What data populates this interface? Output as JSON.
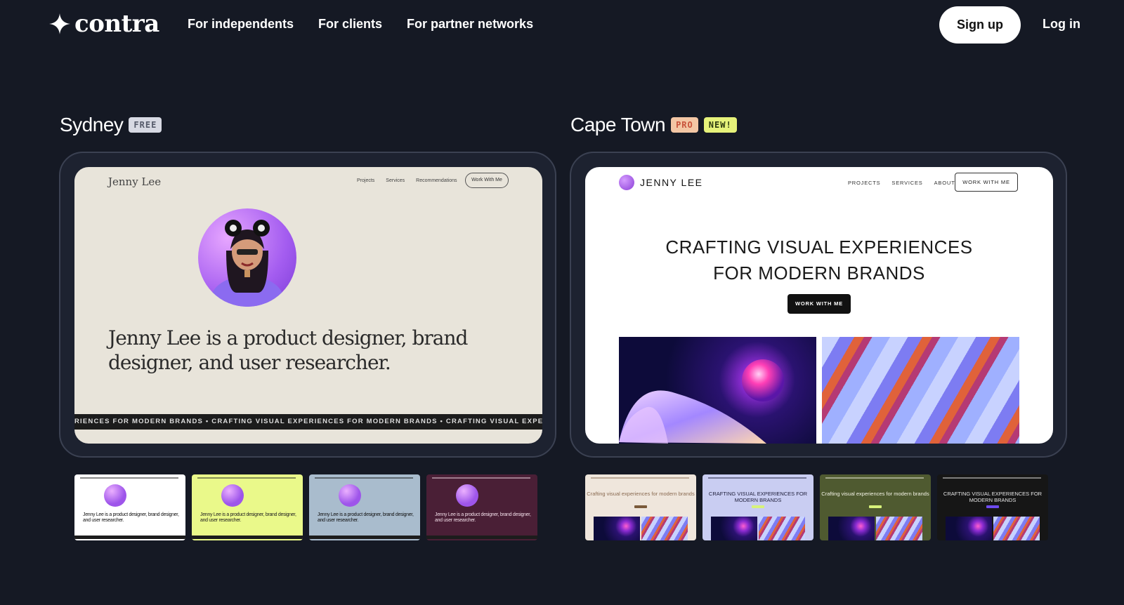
{
  "header": {
    "logo_text": "contra",
    "nav": [
      "For independents",
      "For clients",
      "For partner networks"
    ],
    "signup_label": "Sign up",
    "login_label": "Log in"
  },
  "templates": [
    {
      "name": "Sydney",
      "badges": [
        "FREE"
      ],
      "preview": {
        "brand": "Jenny Lee",
        "nav": [
          "Projects",
          "Services",
          "Recommendations"
        ],
        "cta": "Work With Me",
        "headline": "Jenny Lee is a product designer, brand designer, and user researcher.",
        "marquee": "RIENCES FOR MODERN BRANDS • CRAFTING VISUAL EXPERIENCES FOR MODERN BRANDS • CRAFTING VISUAL EXPERIENCES"
      },
      "variants": [
        {
          "bg": "#ffffff",
          "fg": "#111111",
          "text": "Jenny Lee is a product designer, brand designer, and user researcher."
        },
        {
          "bg": "#eaf98a",
          "fg": "#222222",
          "text": "Jenny Lee is a product designer, brand designer, and user researcher."
        },
        {
          "bg": "#a9bccd",
          "fg": "#111111",
          "text": "Jenny Lee is a product designer, brand designer, and user researcher."
        },
        {
          "bg": "#4a1f36",
          "fg": "#f0dbe6",
          "text": "Jenny Lee is a product designer, brand designer, and user researcher."
        }
      ]
    },
    {
      "name": "Cape Town",
      "badges": [
        "PRO",
        "NEW!"
      ],
      "preview": {
        "brand": "JENNY LEE",
        "nav": [
          "PROJECTS",
          "SERVICES",
          "ABOUT"
        ],
        "cta": "WORK WITH ME",
        "headline_line1": "CRAFTING VISUAL EXPERIENCES",
        "headline_line2": "FOR MODERN BRANDS",
        "button": "WORK WITH ME"
      },
      "variants": [
        {
          "bg": "#efe6dc",
          "fg": "#8a6b52",
          "btn": "#7a5a3a",
          "text": "Crafting visual experiences for modern brands"
        },
        {
          "bg": "#c9cdf2",
          "fg": "#1e1e3a",
          "btn": "#d7f27a",
          "text": "CRAFTING VISUAL EXPERIENCES FOR MODERN BRANDS"
        },
        {
          "bg": "#4f5a30",
          "fg": "#f4f4e6",
          "btn": "#d7f27a",
          "text": "Crafting visual experiences for modern brands"
        },
        {
          "bg": "#161616",
          "fg": "#e5e5e5",
          "btn": "#6e4bf0",
          "text": "CRAFTING VISUAL EXPERIENCES FOR MODERN BRANDS"
        }
      ]
    }
  ],
  "colors": {
    "page_bg": "#151924",
    "frame_border": "#3b4152",
    "accent_pro": "#f3c6a4",
    "accent_new": "#e6f27a"
  },
  "icons": {
    "logo": "four-point-star-icon"
  }
}
